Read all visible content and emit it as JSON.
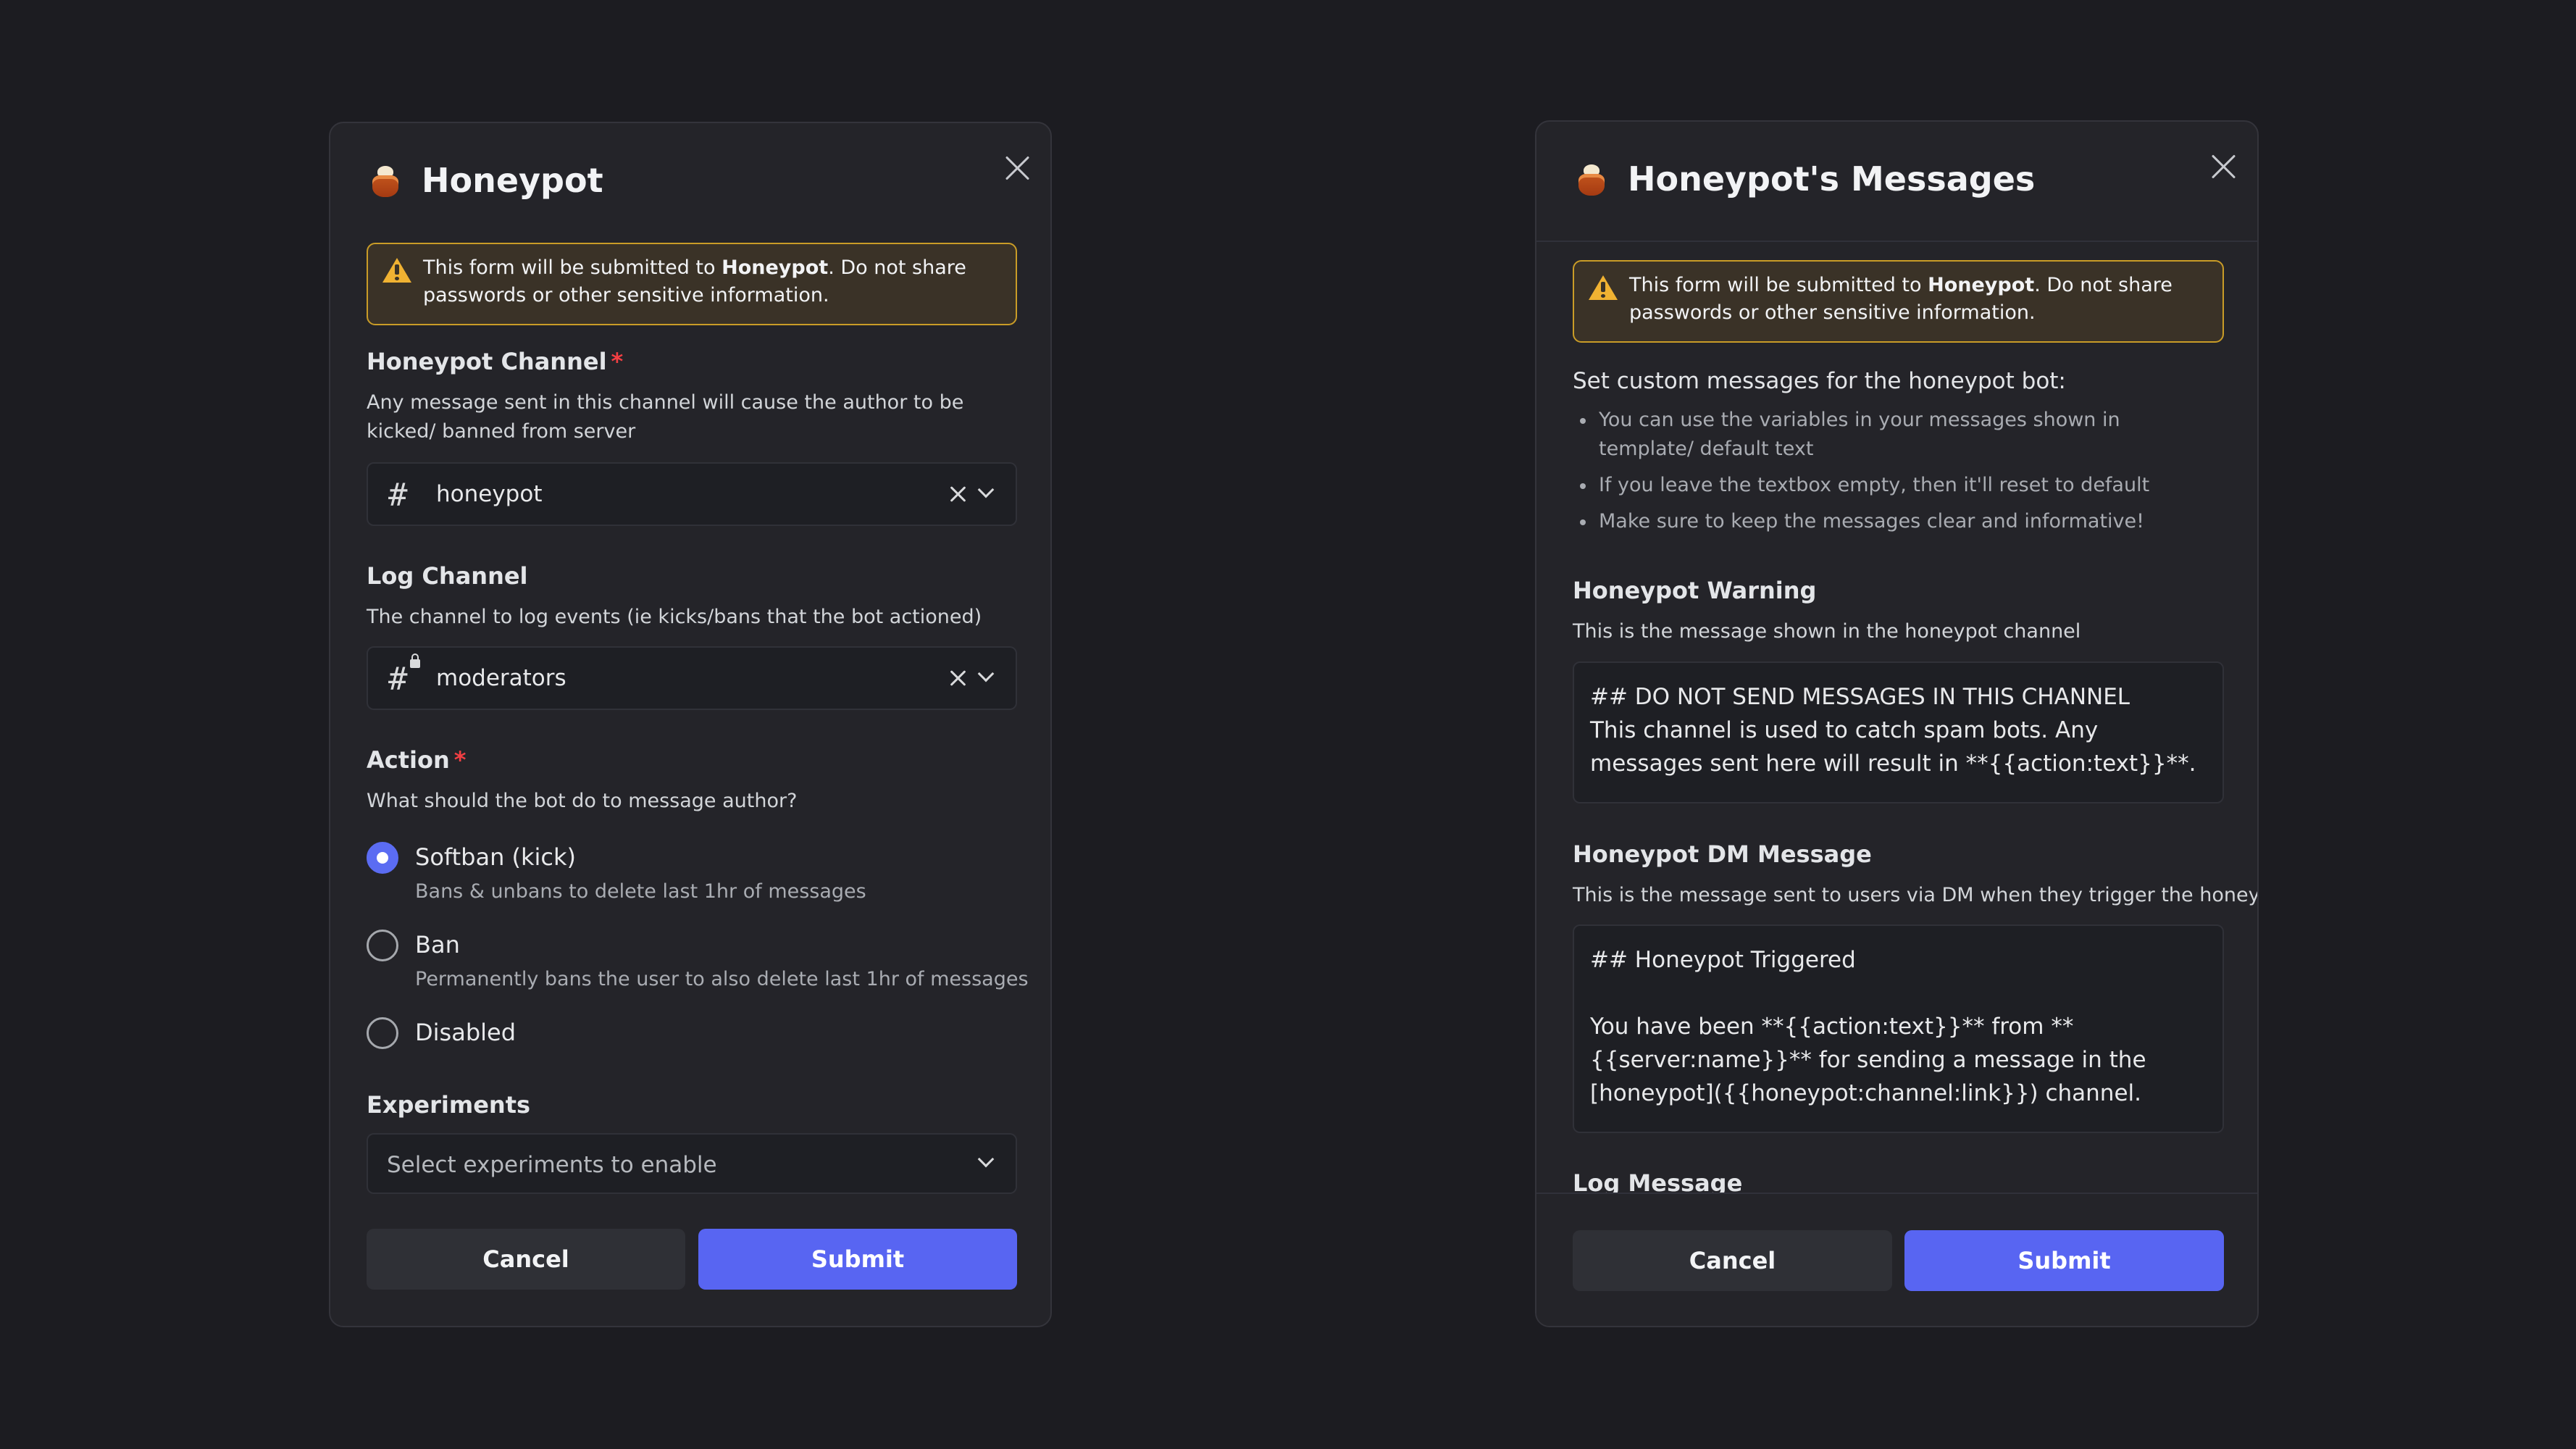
{
  "warning": {
    "prefix": "This form will be submitted to ",
    "app": "Honeypot",
    "suffix": ". Do not share passwords or other sensitive information."
  },
  "left": {
    "title": "Honeypot",
    "honeypot_channel": {
      "label": "Honeypot Channel",
      "required": "*",
      "description": "Any message sent in this channel will cause the author to be kicked/ banned from server",
      "value": "honeypot",
      "icon": "hashtag-icon"
    },
    "log_channel": {
      "label": "Log Channel",
      "description": "The channel to log events (ie kicks/bans that the bot actioned)",
      "value": "moderators",
      "icon": "locked-hashtag-icon"
    },
    "action": {
      "label": "Action",
      "required": "*",
      "description": "What should the bot do to message author?",
      "options": [
        {
          "label": "Softban (kick)",
          "sub": "Bans & unbans to delete last 1hr of messages",
          "selected": true
        },
        {
          "label": "Ban",
          "sub": "Permanently bans the user to also delete last 1hr of messages",
          "selected": false
        },
        {
          "label": "Disabled",
          "sub": "",
          "selected": false
        }
      ]
    },
    "experiments": {
      "label": "Experiments",
      "placeholder": "Select experiments to enable"
    },
    "cancel": "Cancel",
    "submit": "Submit"
  },
  "right": {
    "title": "Honeypot's Messages",
    "intro": "Set custom messages for the honeypot bot:",
    "bullets": [
      "You can use the variables in your messages shown in template/ default text",
      "If you leave the textbox empty, then it'll reset to default",
      "Make sure to keep the messages clear and informative!"
    ],
    "warning_msg": {
      "label": "Honeypot Warning",
      "description": "This is the message shown in the honeypot channel",
      "value": "## DO NOT SEND MESSAGES IN THIS CHANNEL\nThis channel is used to catch spam bots. Any messages sent here will result in **{{action:text}}**."
    },
    "dm_msg": {
      "label": "Honeypot DM Message",
      "description": "This is the message sent to users via DM when they trigger the honeypot",
      "value": "## Honeypot Triggered\n\nYou have been **{{action:text}}** from **{{server:name}}** for sending a message in the [honeypot]({{honeypot:channel:link}}) channel."
    },
    "log_msg": {
      "label": "Log Message"
    },
    "cancel": "Cancel",
    "submit": "Submit"
  },
  "colors": {
    "background": "#1c1c21",
    "modal": "#242429",
    "accent": "#5865f2",
    "warning_border": "#c99c27",
    "warning_bg": "#3a3227",
    "required": "#f23f43"
  }
}
